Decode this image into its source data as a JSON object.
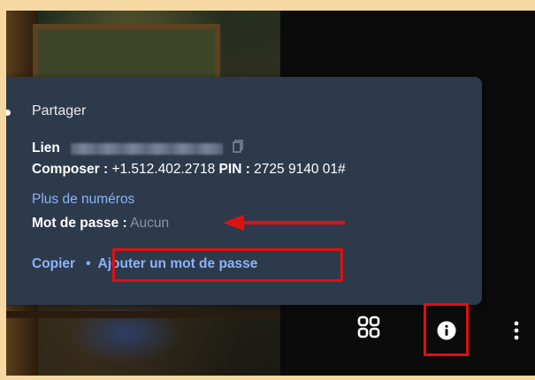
{
  "share_panel": {
    "title": "Partager",
    "link_label": "Lien",
    "dial_label": "Composer :",
    "dial_number": "+1.512.402.2718",
    "pin_label": "PIN :",
    "pin_value": "2725 9140 01#",
    "more_numbers": "Plus de numéros",
    "password_label": "Mot de passe :",
    "password_value": "Aucun",
    "copy": "Copier",
    "separator": "•",
    "add_password": "Ajouter un mot de passe"
  },
  "toolbar": {
    "icons": [
      "grid-icon",
      "info-icon",
      "more-vert-icon"
    ]
  },
  "colors": {
    "panel_bg": "#2d3a4c",
    "link": "#8ab4f8",
    "annotation": "#e01010",
    "outer_bg": "#f6d8a2"
  }
}
